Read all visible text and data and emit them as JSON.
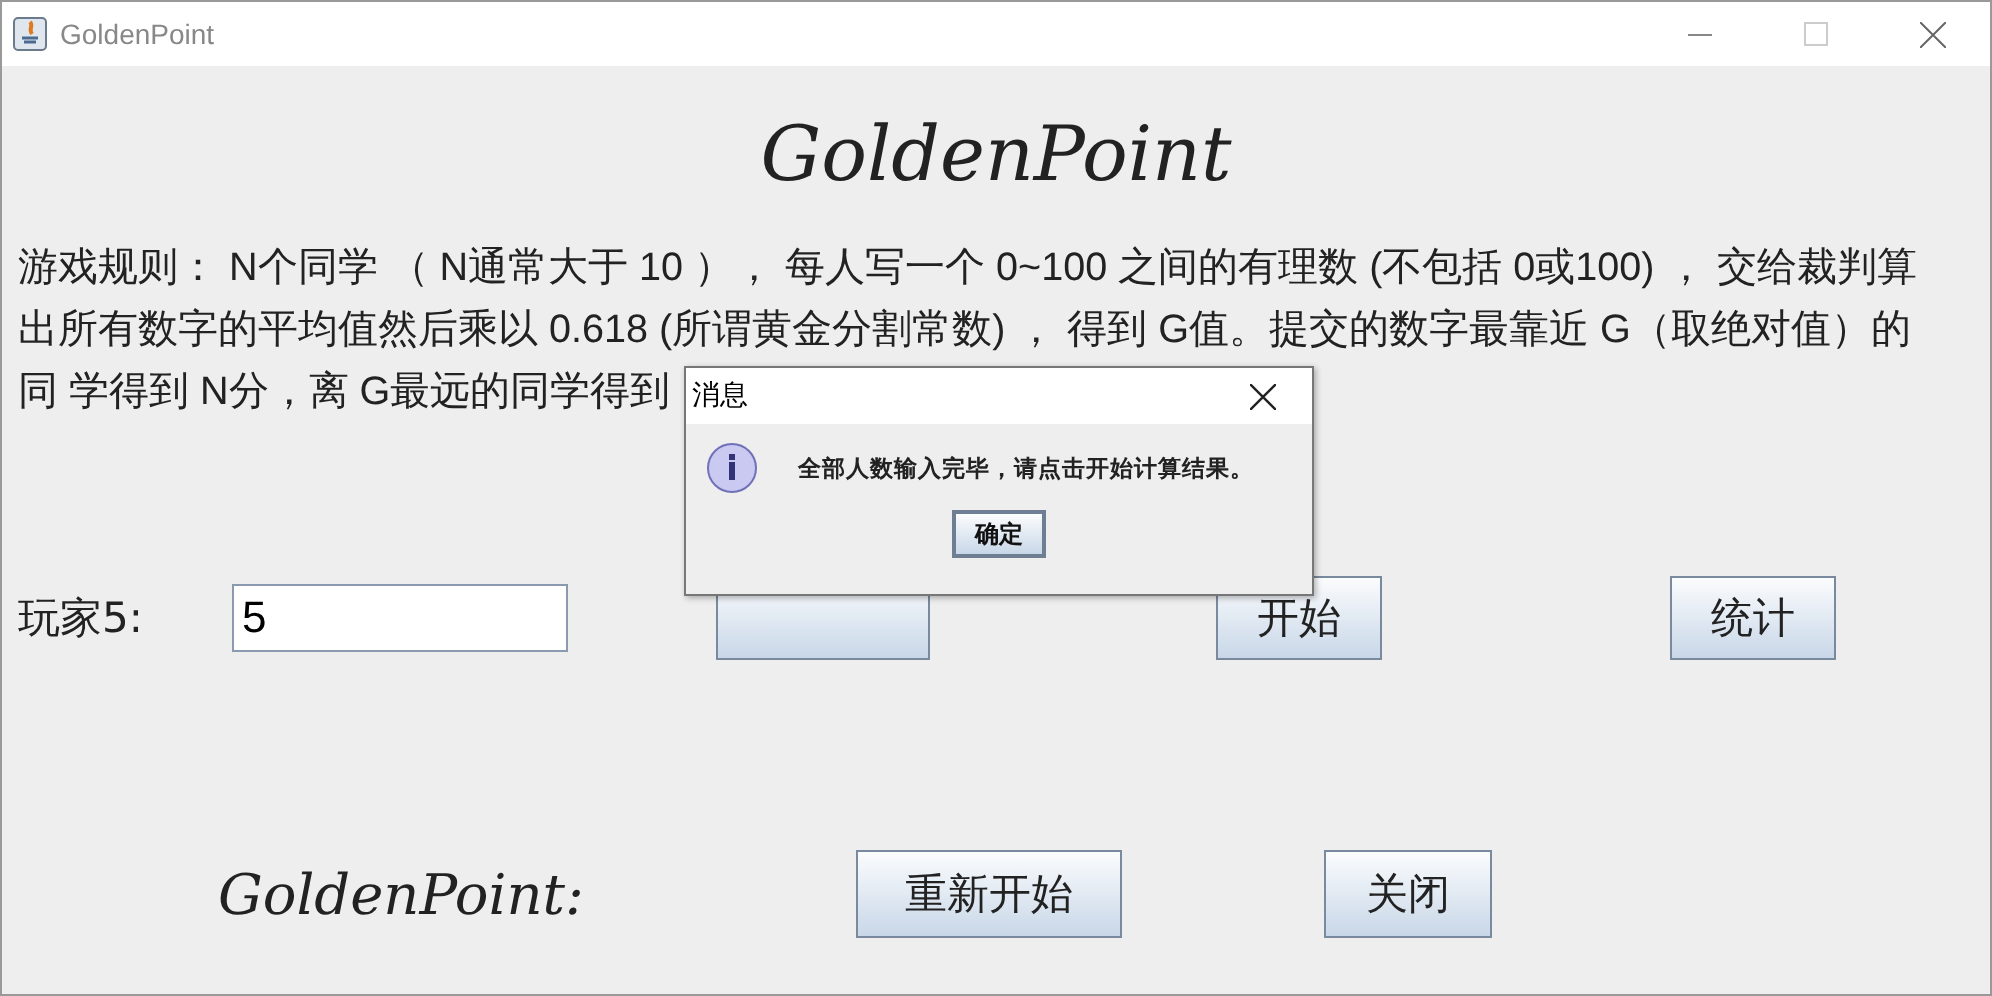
{
  "window": {
    "title": "GoldenPoint"
  },
  "heading": "GoldenPoint",
  "rules": [
    "游戏规则： N个同学 （ N通常大于 10 ）， 每人写一个 0~100 之间的有理数 (不包括 0或100) ， 交给裁判算",
    "出所有数字的平均值然后乘以 0.618 (所谓黄金分割常数) ， 得到 G值。提交的数字最靠近 G（取绝对值）的",
    "同 学得到 N分，离 G最远的同学得到"
  ],
  "player": {
    "label": "玩家5:",
    "value": "5"
  },
  "row_buttons": [
    {
      "label": "开始"
    },
    {
      "label": "统计"
    }
  ],
  "footer": {
    "label": "GoldenPoint:",
    "buttons": [
      "重新开始",
      "关闭"
    ]
  },
  "dialog": {
    "title": "消息",
    "message": "全部人数输入完毕，请点击开始计算结果。",
    "button": "确定"
  }
}
